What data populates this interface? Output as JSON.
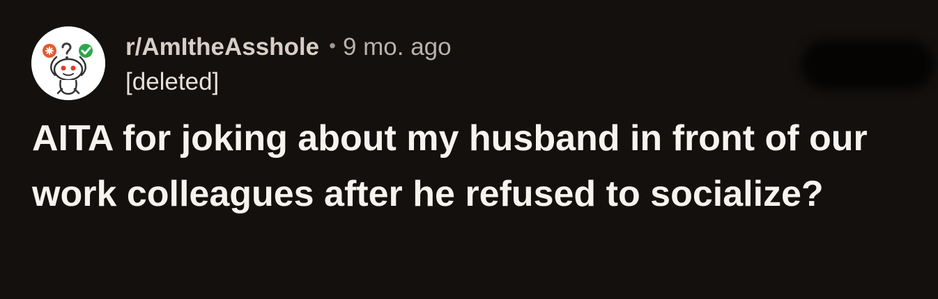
{
  "post": {
    "subreddit": "r/AmItheAsshole",
    "separator": "•",
    "time_ago": "9 mo. ago",
    "author": "[deleted]",
    "title": "AITA for joking about my husband in front of our work colleagues after he refused to socialize?"
  },
  "icons": {
    "avatar": "reddit-snoo-avatar-icon"
  },
  "colors": {
    "background": "#13100e",
    "subreddit_text": "#d8cec6",
    "meta_text": "#b9b2ac",
    "title_text": "#f7f3ef",
    "avatar_accent_green": "#2ca84b",
    "avatar_accent_orange": "#e45a2d"
  }
}
